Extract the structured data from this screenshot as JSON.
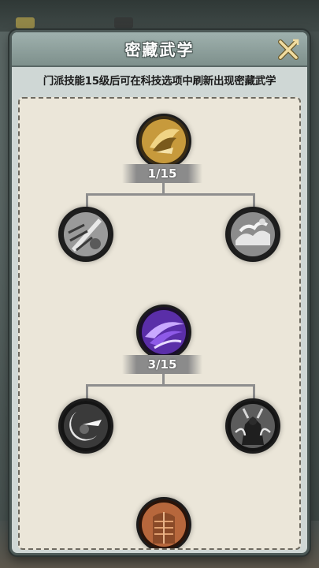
{
  "dialog": {
    "title": "密藏武学",
    "hint": "门派技能15级后可在科技选项中刷新出现密藏武学",
    "close_icon": "close-x-icon"
  },
  "trees": [
    {
      "root": {
        "icon": "golden-claw-skill-icon",
        "level": "1/15",
        "color": "#d4b25a"
      },
      "children": [
        {
          "icon": "sword-slash-skill-icon",
          "color": "#bdbdbd"
        },
        {
          "icon": "cloud-wave-skill-icon",
          "color": "#bdbdbd"
        }
      ]
    },
    {
      "root": {
        "icon": "purple-vortex-skill-icon",
        "level": "3/15",
        "color": "#7a3fd1"
      },
      "children": [
        {
          "icon": "crescent-moon-warrior-skill-icon",
          "color": "#bdbdbd"
        },
        {
          "icon": "demon-figure-skill-icon",
          "color": "#bdbdbd"
        }
      ]
    },
    {
      "root": {
        "icon": "bronze-armor-skill-icon",
        "color": "#b7673c"
      }
    }
  ]
}
